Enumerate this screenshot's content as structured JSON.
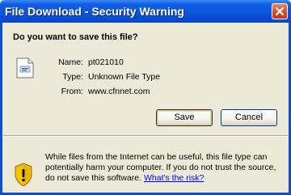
{
  "window": {
    "title": "File Download - Security Warning"
  },
  "dialog": {
    "question": "Do you want to save this file?",
    "file_info": [
      {
        "label": "Name:",
        "value": "pt021010"
      },
      {
        "label": "Type:",
        "value": "Unknown File Type"
      },
      {
        "label": "From:",
        "value": "www.cfnnet.com"
      }
    ],
    "buttons": {
      "save_label": "Save",
      "cancel_label": "Cancel"
    },
    "warning": {
      "text": "While files from the Internet can be useful, this file type can potentially harm your computer. If you do not trust the source, do not save this software.",
      "link_label": "What's the risk?"
    }
  },
  "icons": {
    "close": "close-icon",
    "file": "file-icon",
    "warning": "shield-warning-icon"
  },
  "colors": {
    "titlebar": "#0a55dd",
    "dialog_bg": "#ece9d8",
    "link": "#0000ff",
    "shield_yellow": "#f5c400",
    "close_red": "#d24a2a"
  }
}
